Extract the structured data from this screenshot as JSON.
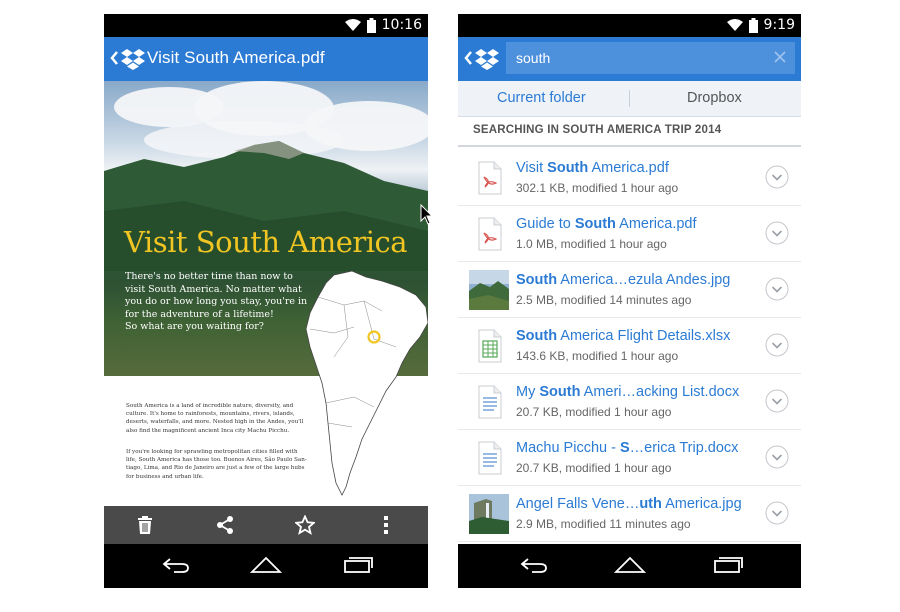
{
  "left_phone": {
    "status_time": "10:16",
    "title": "Visit South America.pdf",
    "document": {
      "heading": "Visit South America",
      "intro_lines": [
        "There's no better time than now to",
        "visit South America. No matter what",
        "you do or how long you stay, you're in",
        "for the adventure of a lifetime!",
        "So what are you waiting for?"
      ],
      "para1_lines": [
        "South America is a land of incredible nature, diversity, and",
        "culture. It's home to rainforests, mountains, rivers, islands,",
        "deserts, waterfalls, and more. Nested high in the Andes, you'll",
        "also find the magnificent ancient Inca city Machu Picchu."
      ],
      "para2_lines": [
        "If you're looking for sprawling metropolitan cities filled with",
        "life, South America has those too. Buenos Aires, São Paulo San-",
        "tiago, Lima, and Rio de Janeiro are just a few of the large hubs",
        "for business and urban life."
      ]
    },
    "toolbar_icons": [
      "delete-icon",
      "share-icon",
      "star-icon",
      "more-icon"
    ]
  },
  "right_phone": {
    "status_time": "9:19",
    "search": {
      "value": "south"
    },
    "scope": {
      "current_folder": "Current folder",
      "dropbox": "Dropbox"
    },
    "searching_in": "SEARCHING IN SOUTH AMERICA TRIP 2014",
    "results": [
      {
        "icon": "pdf-icon",
        "title_pre": "Visit ",
        "title_match": "South",
        "title_post": " America.pdf",
        "meta": "302.1 KB, modified 1 hour ago"
      },
      {
        "icon": "pdf-icon",
        "title_pre": "Guide to ",
        "title_match": "South",
        "title_post": " America.pdf",
        "meta": "1.0 MB, modified 1 hour ago"
      },
      {
        "icon": "photo-andes-thumb",
        "title_pre": "",
        "title_match": "South",
        "title_post": " America…ezula Andes.jpg",
        "meta": "2.5 MB, modified 14 minutes ago"
      },
      {
        "icon": "spreadsheet-icon",
        "title_pre": "",
        "title_match": "South",
        "title_post": " America Flight Details.xlsx",
        "meta": "143.6 KB, modified 1 hour ago"
      },
      {
        "icon": "document-icon",
        "title_pre": "My ",
        "title_match": "South",
        "title_post": " Ameri…acking List.docx",
        "meta": "20.7 KB, modified 1 hour ago"
      },
      {
        "icon": "document-icon",
        "title_pre": "Machu Picchu - ",
        "title_match": "S",
        "title_post": "…erica Trip.docx",
        "meta": "20.7 KB, modified 1 hour ago"
      },
      {
        "icon": "photo-falls-thumb",
        "title_pre": "Angel Falls Vene…",
        "title_match": "uth",
        "title_post": " America.jpg",
        "meta": "2.9 MB, modified 11 minutes ago"
      }
    ]
  },
  "colors": {
    "brand_blue": "#2b7bd4",
    "hero_yellow": "#f1c522",
    "toolbar_gray": "#4a4a4a"
  }
}
